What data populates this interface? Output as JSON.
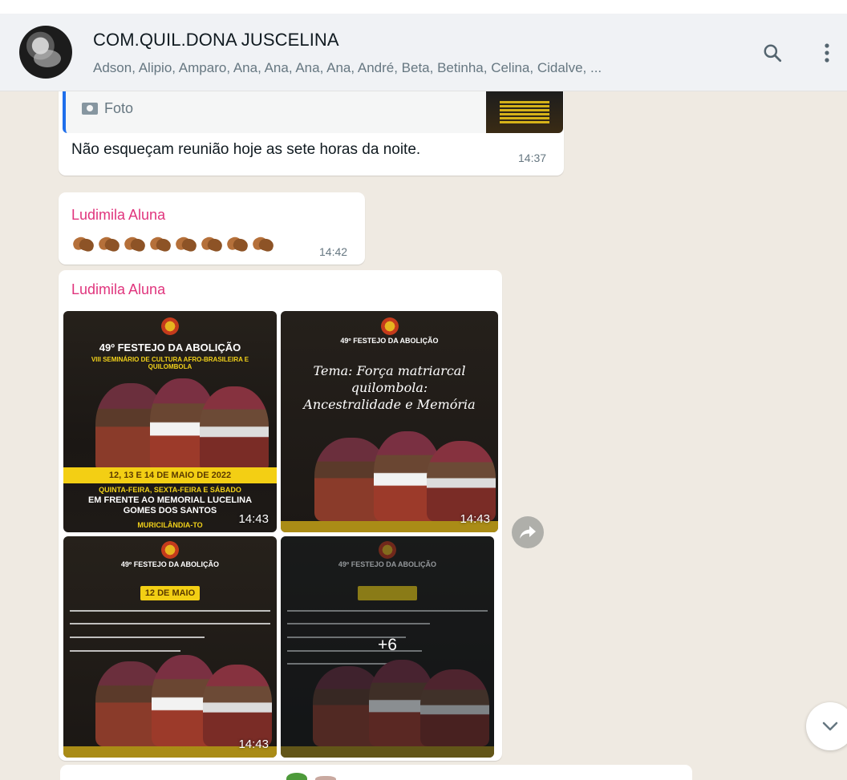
{
  "header": {
    "title": "COM.QUIL.DONA JUSCELINA",
    "members": "Adson, Alipio, Amparo, Ana, Ana, Ana, Ana, André, Beta, Betinha, Celina, Cidalve, ..."
  },
  "messages": [
    {
      "quoted_label": "Foto",
      "text": "Não esqueçam reunião hoje as sete horas da noite.",
      "time": "14:37"
    },
    {
      "sender": "Ludimila Aluna",
      "emoji_count": 8,
      "time": "14:42"
    },
    {
      "sender": "Ludimila Aluna",
      "album": {
        "tile1": {
          "title": "49º FESTEJO DA ABOLIÇÃO",
          "subtitle": "VIII SEMINÁRIO DE CULTURA AFRO-BRASILEIRA E QUILOMBOLA",
          "dates": "12, 13 E 14 DE MAIO DE 2022",
          "days": "QUINTA-FEIRA, SEXTA-FEIRA E SÁBADO",
          "place": "EM FRENTE AO MEMORIAL LUCELINA GOMES DOS SANTOS",
          "city": "MURICILÂNDIA-TO",
          "time": "14:43"
        },
        "tile2": {
          "title": "49º FESTEJO DA ABOLIÇÃO",
          "theme": "Tema: Força matriarcal quilombola: Ancestralidade e Memória",
          "time": "14:43"
        },
        "tile3": {
          "title": "49º FESTEJO DA ABOLIÇÃO",
          "date_badge": "12 DE MAIO",
          "time": "14:43"
        },
        "tile4": {
          "title": "49º FESTEJO DA ABOLIÇÃO",
          "more_count": "+6"
        }
      }
    }
  ],
  "colors": {
    "sender": "#e0357d",
    "accent_quote": "#1f6feb",
    "chat_bg": "#efeae2"
  },
  "icons": [
    "search-icon",
    "menu-icon",
    "camera-icon",
    "forward-icon",
    "chevron-down-icon"
  ]
}
